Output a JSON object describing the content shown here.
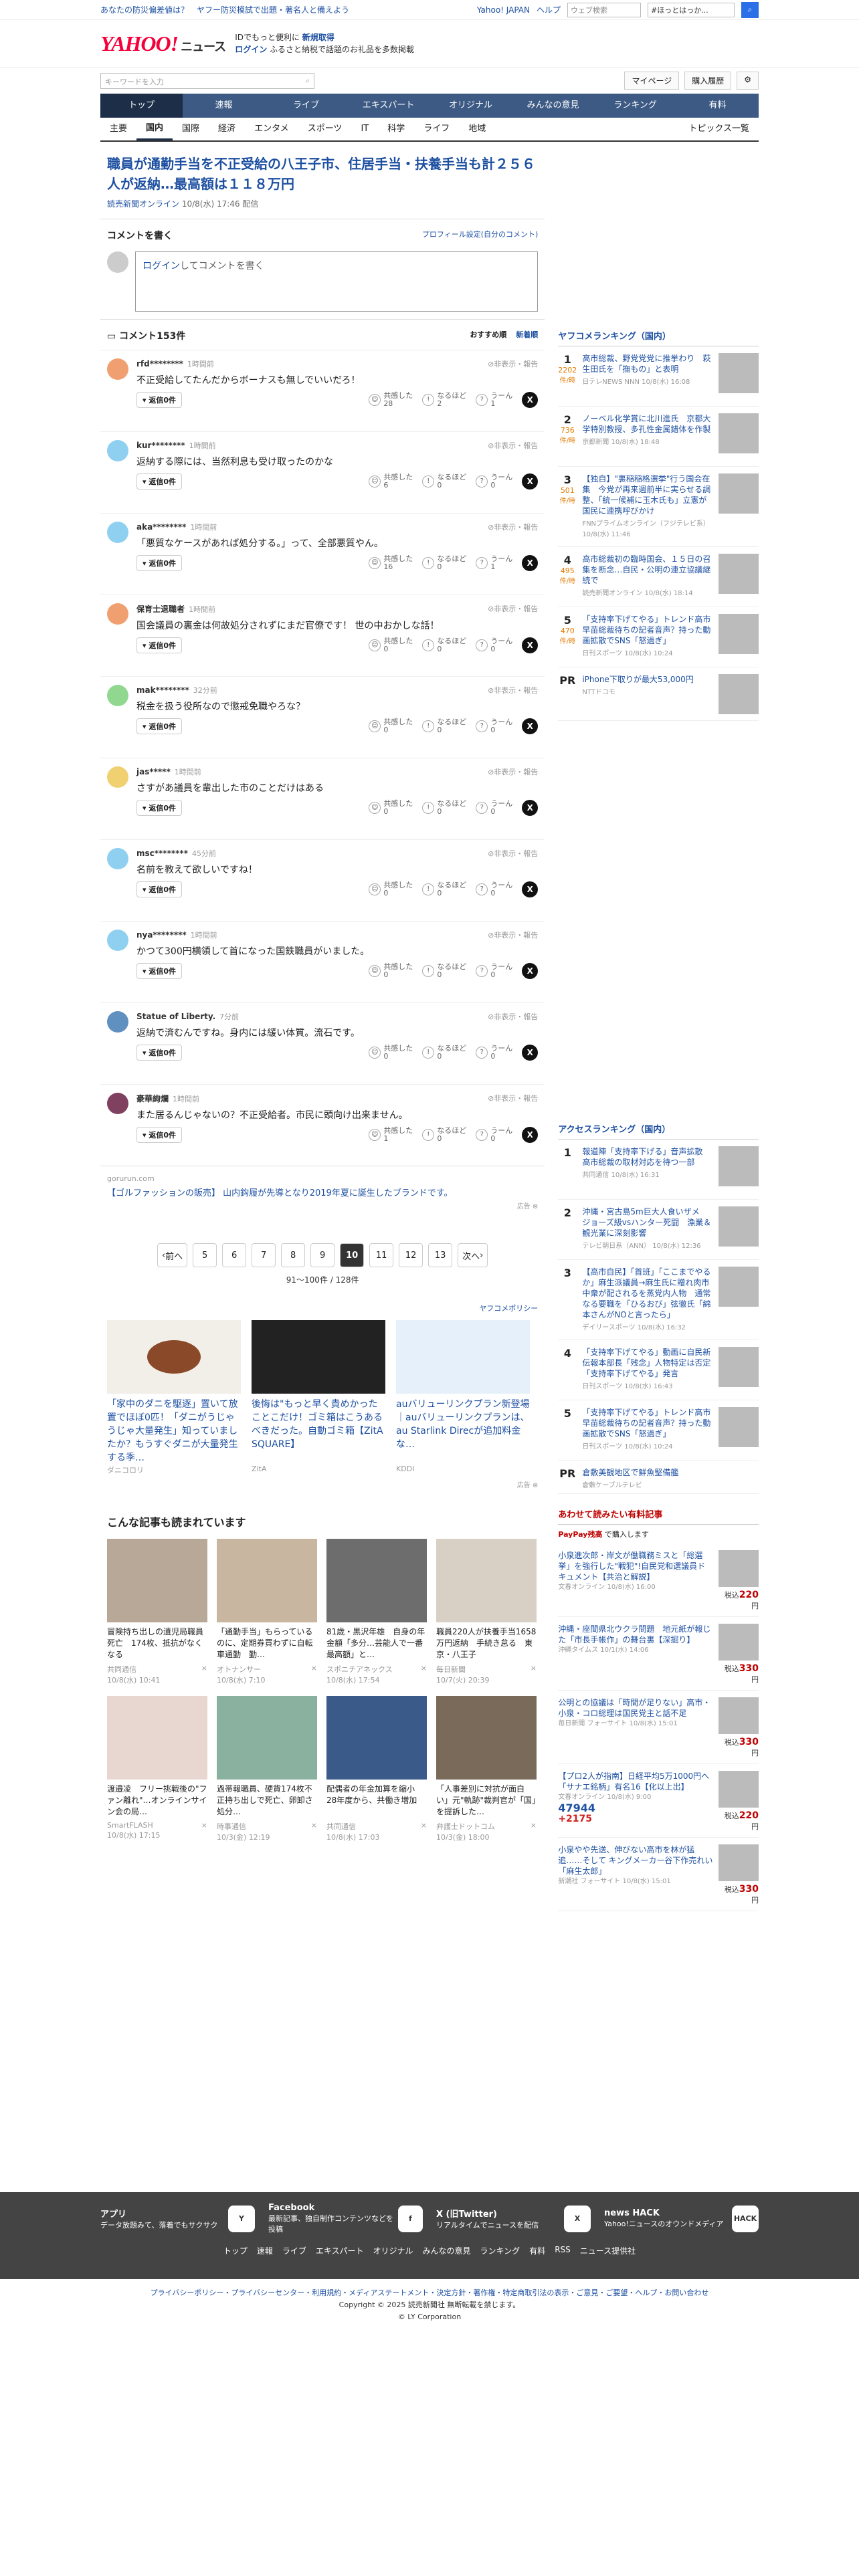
{
  "topbar": {
    "links": [
      "あなたの防災偏差値は？",
      "ヤフー防災模試で出題・著名人と備えよう"
    ],
    "right_links": [
      "Yahoo! JAPAN",
      "ヘルプ"
    ],
    "search_placeholder": "ウェブ検索",
    "mini_search_value": "#ほっとはっか..."
  },
  "header": {
    "logo": "YAHOO!",
    "logo_sub": "JAPAN",
    "service": "ニュース",
    "line1": "IDでもっと便利に",
    "line1_link": "新規取得",
    "line2_link": "ログイン",
    "line2": "ふるさと納税で話題のお礼品を多数掲載"
  },
  "search": {
    "placeholder": "キーワードを入力",
    "mypage": "マイページ",
    "purchased": "購入履歴"
  },
  "mainnav": [
    "トップ",
    "速報",
    "ライブ",
    "エキスパート",
    "オリジナル",
    "みんなの意見",
    "ランキング",
    "有料"
  ],
  "subnav": [
    "主要",
    "国内",
    "国際",
    "経済",
    "エンタメ",
    "スポーツ",
    "IT",
    "科学",
    "ライフ",
    "地域"
  ],
  "subnav_right": "トピックス一覧",
  "article": {
    "title": "職員が通勤手当を不正受給の八王子市、住居手当・扶養手当も計２５６人が返納…最高額は１１８万円",
    "source": "読売新聞オンライン",
    "date": "10/8(水) 17:46 配信"
  },
  "comment_form": {
    "title": "コメントを書く",
    "profile_link": "プロフィール設定(自分のコメント)",
    "login": "ログイン",
    "placeholder": "してコメントを書く"
  },
  "comments_header": {
    "count": "コメント153件",
    "sort1": "おすすめ順",
    "sort2": "新着順"
  },
  "comments": [
    {
      "user": "rfd********",
      "time": "1時間前",
      "text": "不正受給してたんだからボーナスも無しでいいだろ！",
      "kyokan": "28",
      "naruhodo": "2",
      "uun": "1",
      "color": "#f0a070"
    },
    {
      "user": "kur********",
      "time": "1時間前",
      "text": "返納する際には、当然利息も受け取ったのかな",
      "kyokan": "6",
      "naruhodo": "0",
      "uun": "0",
      "color": "#8fd0f0"
    },
    {
      "user": "aka********",
      "time": "1時間前",
      "text": "「悪質なケースがあれば処分する。」って、全部悪質やん。",
      "kyokan": "16",
      "naruhodo": "0",
      "uun": "1",
      "color": "#8fd0f0"
    },
    {
      "user": "保育士退職者",
      "time": "1時間前",
      "text": "国会議員の裏金は何故処分されずにまだ官僚です！\n世の中おかしな話！",
      "kyokan": "0",
      "naruhodo": "0",
      "uun": "0",
      "color": "#f0a070"
    },
    {
      "user": "mak********",
      "time": "32分前",
      "text": "税金を扱う役所なので懲戒免職やろな？",
      "kyokan": "0",
      "naruhodo": "0",
      "uun": "0",
      "color": "#90d890"
    },
    {
      "user": "jas*****",
      "time": "1時間前",
      "text": "さすがあ議員を輩出した市のことだけはある",
      "kyokan": "0",
      "naruhodo": "0",
      "uun": "0",
      "color": "#f0d070"
    },
    {
      "user": "msc********",
      "time": "45分前",
      "text": "名前を教えて欲しいですね！",
      "kyokan": "0",
      "naruhodo": "0",
      "uun": "0",
      "color": "#8fd0f0"
    },
    {
      "user": "nya********",
      "time": "1時間前",
      "text": "かつて300円横領して首になった国鉄職員がいました。",
      "kyokan": "0",
      "naruhodo": "0",
      "uun": "0",
      "color": "#8fd0f0"
    },
    {
      "user": "Statue of Liberty.",
      "time": "7分前",
      "text": "返納で済むんですね。身内には緩い体質。流石です。",
      "kyokan": "0",
      "naruhodo": "0",
      "uun": "0",
      "color": "#6090c0"
    },
    {
      "user": "豪華絢爛",
      "time": "1時間前",
      "text": "また居るんじゃないの？不正受給者。市民に頭向け出来ません。",
      "kyokan": "1",
      "naruhodo": "0",
      "uun": "0",
      "color": "#804060"
    }
  ],
  "comment_labels": {
    "reply": "返信0件",
    "kyokan": "共感した",
    "naruhodo": "なるほど",
    "uun": "うーん",
    "report": "非表示・報告"
  },
  "inline_ad": {
    "source": "gorurun.com",
    "text": "【ゴルファッションの販売】 山内鈎履が先導となり2019年夏に誕生したブランドです。",
    "label": "広告"
  },
  "pager": {
    "prev": "前へ",
    "pages": [
      "5",
      "6",
      "7",
      "8",
      "9",
      "10",
      "11",
      "12",
      "13"
    ],
    "current": "10",
    "next": "次へ",
    "count": "91〜100件 / 128件"
  },
  "yahoo_ad_label": "ヤフコメポリシー",
  "ads": [
    {
      "text": "「家中のダニを駆逐」置いて放置でほぼ0匹！「ダニがうじゃうじゃ大量発生」知っていましたか？もうすぐダニが大量発生する季…",
      "sponsor": "ダニコロリ"
    },
    {
      "text": "後悔は\"もっと早く貴めかったことこだけ！ゴミ箱はこうあるべきだった。自動ゴミ箱【ZitA SQUARE】",
      "sponsor": "ZitA"
    },
    {
      "text": "auバリューリンクプラン新登場｜auバリューリンクプランは、au Starlink Direcが追加料金な…",
      "sponsor": "KDDI"
    }
  ],
  "ads_label": "広告",
  "related": {
    "title": "こんな記事も読まれています",
    "items": [
      {
        "title": "冒険持ち出しの遺児局職員死亡　174枚、抵抗がなくなる",
        "src": "共同通信",
        "date": "10/8(水) 10:41"
      },
      {
        "title": "「通勤手当」もらっているのに、定期券買わずに自転車通勤　勤…",
        "src": "オトナンサー",
        "date": "10/8(水) 7:10"
      },
      {
        "title": "81歳・黒沢年雄　自身の年金額「多分…芸能人で一番最高額」と…",
        "src": "スポニチアネックス",
        "date": "10/8(水) 17:54"
      },
      {
        "title": "職員220人が扶養手当1658万円返納　手続き怠る　東京・八王子",
        "src": "毎日新聞",
        "date": "10/7(火) 20:39"
      },
      {
        "title": "渡邉凌　フリー挑戦後の\"ファン離れ\"…オンラインサイン会の局…",
        "src": "SmartFLASH",
        "date": "10/8(水) 17:15"
      },
      {
        "title": "過帯報職員、硬貨174枚不正持ち出しで死亡、卵卸さ処分…",
        "src": "時事通信",
        "date": "10/3(金) 12:19"
      },
      {
        "title": "配偶者の年金加算を縮小　28年度から、共働き増加",
        "src": "共同通信",
        "date": "10/8(水) 17:03"
      },
      {
        "title": "「人事差別に対抗が面白い」元\"軌跡\"裁判官が「国」を提訴した…",
        "src": "弁護士ドットコム",
        "date": "10/3(金) 18:00"
      }
    ]
  },
  "sidebar": {
    "ranking_title": "ヤフコメランキング（国内）",
    "ranking": [
      {
        "num": "1",
        "count": "2202",
        "unit": "件/時",
        "title": "高市総裁、野党党党に推挙わり　萩生田氏を「撫もの」と表明",
        "src": "日テレNEWS NNN",
        "date": "10/8(水) 16:08"
      },
      {
        "num": "2",
        "count": "736",
        "unit": "件/時",
        "title": "ノーベル化学賞に北川進氏　京都大学特別教授、多孔性金属錯体を作製",
        "src": "京都新聞 10/8(水) 18:48",
        "date": ""
      },
      {
        "num": "3",
        "count": "501",
        "unit": "件/時",
        "title": "【独自】\"裏稲稲格選挙\"行う国会在集　今党が再来週前半に実らせる調整、「統一候補に玉木氏も」立憲が国民に連携呼びかけ",
        "src": "FNNプライムオンライン（フジテレビ系）",
        "date": "10/8(水) 11:46"
      },
      {
        "num": "4",
        "count": "495",
        "unit": "件/時",
        "title": "高市総裁初の臨時国会、１５日の召集を断念…自民・公明の連立協議継続で",
        "src": "読売新聞オンライン",
        "date": "10/8(水) 18:14"
      },
      {
        "num": "5",
        "count": "470",
        "unit": "件/時",
        "title": "「支持率下げてやる」トレンド高市早苗総裁待ちの記者音声？持った動画拡散でSNS「怒過ぎ」",
        "src": "日刊スポーツ",
        "date": "10/8(水) 10:24"
      }
    ],
    "pr": {
      "label": "PR",
      "title": "iPhone下取りが最大53,000円",
      "src": "NTTドコモ"
    },
    "access_title": "アクセスランキング（国内）",
    "access": [
      {
        "num": "1",
        "title": "報道陣「支持率下げる」音声拡散　高市総裁の取材対応を待つ一部",
        "src": "共同通信 10/8(水) 16:31"
      },
      {
        "num": "2",
        "title": "沖縄・宮古島5m巨大人食いザメ　ジョーズ級vsハンター死闘　漁業＆観光業に深刻影響",
        "src": "テレビ朝日系（ANN） 10/8(水) 12:36"
      },
      {
        "num": "3",
        "title": "【高市自民】「首班」「ここまでやるか」麻生派議員→麻生氏に贈れ肉市中衆が配されるを蒸党内人物　通常なる要職を「ひるおび」弦徹氏「綿本さんがNOと言ったら」",
        "src": "デイリースポーツ 10/8(水) 16:32"
      },
      {
        "num": "4",
        "title": "「支持率下げてやる」動画に自民新伝報本部長「残念」人物特定は否定「支持率下げてやる」発言",
        "src": "日刊スポーツ 10/8(水) 16:43"
      },
      {
        "num": "5",
        "title": "「支持率下げてやる」トレンド高市早苗総裁待ちの記者音声？持った動画拡散でSNS「怒過ぎ」",
        "src": "日刊スポーツ 10/8(水) 10:24"
      }
    ],
    "pr2": {
      "label": "PR",
      "title": "倉敷美観地区で鮮魚堅備艦",
      "src": "倉敷ケーブルテレビ"
    },
    "shop_title": "あわせて読みたい有料記事",
    "shop_brand": "PayPay残高",
    "shop_brand_note": "で購入します",
    "shop": [
      {
        "title": "小泉進次郎・岸文が働職務ミスと「総選挙」を強行した\"戦犯\"!自民党和選議員ドキュメント【共治と解説】",
        "src": "文春オンライン 10/8(水) 16:00",
        "price": "220"
      },
      {
        "title": "沖縄・座間県北ウクラ問題　地元紙が報じた「市長手帳作」の舞台裏【深掘り】",
        "src": "沖縄タイムス 10/1(水) 14:06",
        "price": "330"
      },
      {
        "title": "公明との協議は「時間が足りない」高市・小泉・コロ総理は国民党主と話不足",
        "src": "毎日新聞 フォーサイト 10/8(水) 15:01",
        "price": "330"
      },
      {
        "title": "【プロ2人が指南】日経平均5万1000円へ「サナエ銘柄」有名16【化以上出】",
        "src": "文春オンライン 10/8(水) 9:00",
        "price": "220",
        "ticker": "47944",
        "change": "+2175"
      },
      {
        "title": "小泉やや先送、伸びない高市を林が猛追……そして キングメーカー谷下作売れい「麻生太郎」",
        "src": "新潮社 フォーサイト 10/8(水) 15:01",
        "price": "330"
      }
    ],
    "price_prefix": "税込",
    "price_unit": "円"
  },
  "footer": {
    "apps": [
      {
        "title": "アプリ",
        "desc": "データ放題みて、落着でもサクサク",
        "icon": "Y"
      },
      {
        "title": "Facebook",
        "desc": "最新記事、独自制作コンテンツなどを投稿",
        "icon": "f"
      },
      {
        "title": "X (旧Twitter)",
        "desc": "リアルタイムでニュースを配信",
        "icon": "X"
      },
      {
        "title": "news HACK",
        "desc": "Yahoo!ニュースのオウンドメディア",
        "icon": "HACK"
      }
    ],
    "nav": [
      "トップ",
      "速報",
      "ライブ",
      "エキスパート",
      "オリジナル",
      "みんなの意見",
      "ランキング",
      "有料",
      "RSS",
      "ニュース提供社"
    ],
    "legal_links": "プライバシーポリシー・プライバシーセンター・利用規約・メディアステートメント・決定方針・著作権・特定商取引法の表示・ご意見・ご要望・ヘルプ・お問い合わせ",
    "copyright": "Copyright © 2025 読売新聞社 無断転載を禁じます。",
    "corp": "© LY Corporation"
  }
}
